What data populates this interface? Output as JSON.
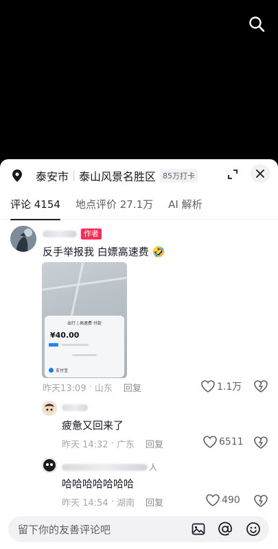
{
  "location": {
    "city": "泰安市",
    "place": "泰山风景名胜区",
    "checkins": "85万打卡"
  },
  "tabs": [
    {
      "label": "评论 4154",
      "active": true
    },
    {
      "label": "地点评价 27.1万",
      "active": false
    },
    {
      "label": "AI 解析",
      "active": false
    }
  ],
  "comments": [
    {
      "author_tag": "作者",
      "text": "反手举报我  白嫖高速费 🤣",
      "time": "昨天13:09",
      "region": "山东",
      "reply": "回复",
      "likes": "1.1万",
      "image": {
        "pay_title": "出行 | 高速费 付款",
        "amount": "¥40.00",
        "method": "支付宝"
      }
    },
    {
      "text": "疲惫又回来了",
      "time": "昨天 14:32",
      "region": "广东",
      "reply": "回复",
      "likes": "6511"
    },
    {
      "nick_suffix": "人",
      "text": "哈哈哈哈哈哈哈",
      "time": "昨天 14:54",
      "region": "湖南",
      "reply": "回复",
      "likes": "490"
    }
  ],
  "input": {
    "placeholder": "留下你的友善评论吧"
  },
  "colors": {
    "accent": "#fe2c55",
    "text": "#161823",
    "muted": "#a6a7ac"
  },
  "icons": [
    "search-icon",
    "location-pin-icon",
    "expand-icon",
    "close-icon",
    "heart-icon",
    "dislike-icon",
    "image-icon",
    "at-icon",
    "emoji-icon"
  ]
}
